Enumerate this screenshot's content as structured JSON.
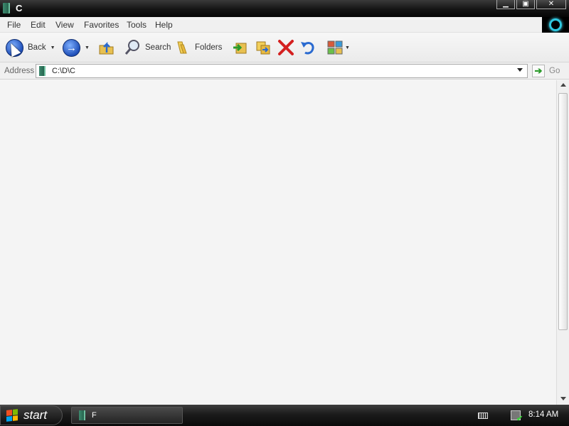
{
  "window": {
    "title": "C",
    "controls": {
      "minimize": "▁",
      "maximize": "▣",
      "close": "✕"
    }
  },
  "menu": {
    "items": [
      "File",
      "Edit",
      "View",
      "Favorites",
      "Tools",
      "Help"
    ]
  },
  "toolbar": {
    "back_label": "Back",
    "search_label": "Search",
    "folders_label": "Folders",
    "icons": [
      "back-icon",
      "forward-icon",
      "up-folder-icon",
      "search-icon",
      "folders-icon",
      "move-to-icon",
      "copy-to-icon",
      "delete-icon",
      "undo-icon",
      "views-icon"
    ]
  },
  "address": {
    "label": "Address",
    "value": "C:\\D\\C",
    "go_label": "Go"
  },
  "taskbar": {
    "start_label": "start",
    "task_label": "F",
    "clock": "8:14 AM"
  },
  "colors": {
    "titlebar": "#141414",
    "accent_ring": "#2ec8e0",
    "go_arrow": "#2a9a2a",
    "delete_red": "#d42020"
  }
}
